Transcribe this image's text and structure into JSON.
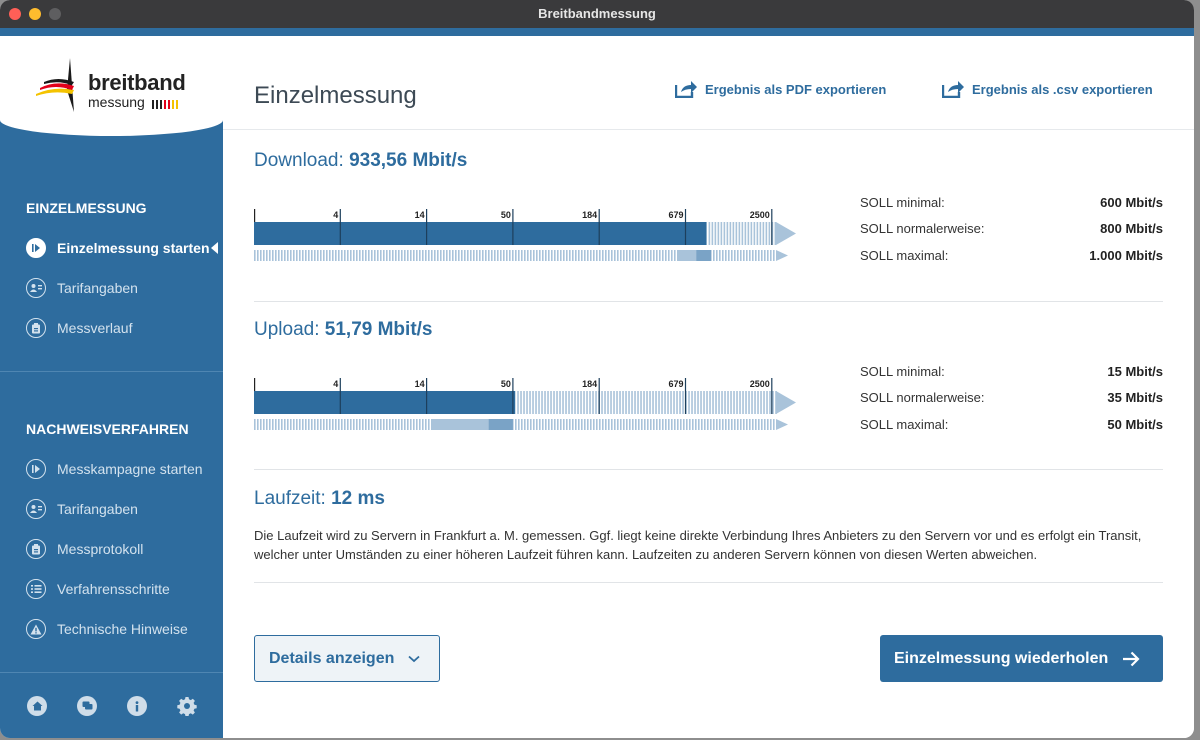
{
  "window": {
    "title": "Breitbandmessung"
  },
  "logo": {
    "line1": "breitband",
    "line2": "messung"
  },
  "sidebar": {
    "section1": "EINZELMESSUNG",
    "items1": [
      {
        "label": "Einzelmessung starten",
        "icon": "play-icon",
        "active": true
      },
      {
        "label": "Tarifangaben",
        "icon": "tariff-icon"
      },
      {
        "label": "Messverlauf",
        "icon": "history-icon"
      }
    ],
    "section2": "NACHWEISVERFAHREN",
    "items2": [
      {
        "label": "Messkampagne starten",
        "icon": "play-icon"
      },
      {
        "label": "Tarifangaben",
        "icon": "tariff-icon"
      },
      {
        "label": "Messprotokoll",
        "icon": "protocol-icon"
      },
      {
        "label": "Verfahrensschritte",
        "icon": "list-icon"
      },
      {
        "label": "Technische Hinweise",
        "icon": "warning-icon"
      }
    ],
    "bottom_icons": [
      "home-icon",
      "chat-icon",
      "info-icon",
      "gear-icon"
    ]
  },
  "header": {
    "title": "Einzelmessung",
    "export_pdf": "Ergebnis als PDF exportieren",
    "export_csv": "Ergebnis als .csv exportieren"
  },
  "download": {
    "label": "Download:",
    "value": "933,56 Mbit/s",
    "value_mbit": 933.56,
    "soll": [
      {
        "label": "SOLL minimal:",
        "value": "600 Mbit/s",
        "mbit": 600
      },
      {
        "label": "SOLL normalerweise:",
        "value": "800 Mbit/s",
        "mbit": 800
      },
      {
        "label": "SOLL maximal:",
        "value": "1.000 Mbit/s",
        "mbit": 1000
      }
    ]
  },
  "upload": {
    "label": "Upload:",
    "value": "51,79 Mbit/s",
    "value_mbit": 51.79,
    "soll": [
      {
        "label": "SOLL minimal:",
        "value": "15 Mbit/s",
        "mbit": 15
      },
      {
        "label": "SOLL normalerweise:",
        "value": "35 Mbit/s",
        "mbit": 35
      },
      {
        "label": "SOLL maximal:",
        "value": "50 Mbit/s",
        "mbit": 50
      }
    ]
  },
  "scale_ticks": [
    "4",
    "14",
    "50",
    "184",
    "679",
    "2500"
  ],
  "latency": {
    "label": "Laufzeit:",
    "value": "12 ms",
    "description": "Die Laufzeit wird zu Servern in Frankfurt a. M. gemessen. Ggf. liegt keine direkte Verbindung Ihres Anbieters zu den Servern vor und es erfolgt ein Transit, welcher unter Umständen zu einer höheren Laufzeit führen kann. Laufzeiten zu anderen Servern können von diesen Werten abweichen."
  },
  "buttons": {
    "details": "Details anzeigen",
    "repeat": "Einzelmessung wiederholen"
  },
  "colors": {
    "primary": "#2e6c9e",
    "light_bar": "#a9c3da",
    "mid_bar": "#7aa3c6"
  }
}
